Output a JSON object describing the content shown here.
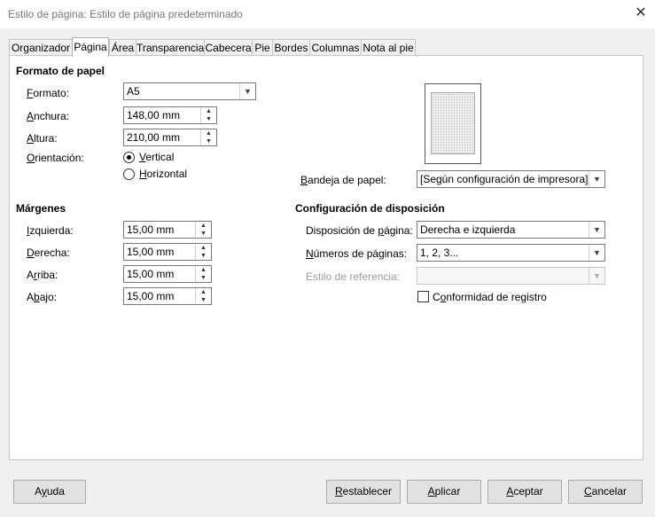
{
  "window": {
    "title": "Estilo de página: Estilo de página predeterminado",
    "close_glyph": "✕"
  },
  "tabs": [
    {
      "label": "Organizador",
      "active": false
    },
    {
      "label": "Página",
      "active": true
    },
    {
      "label": "Área",
      "active": false
    },
    {
      "label": "Transparencia",
      "active": false
    },
    {
      "label": "Cabecera",
      "active": false
    },
    {
      "label": "Pie",
      "active": false
    },
    {
      "label": "Bordes",
      "active": false
    },
    {
      "label": "Columnas",
      "active": false
    },
    {
      "label": "Nota al pie",
      "active": false
    }
  ],
  "paper_format": {
    "heading": "Formato de papel",
    "format": {
      "label_ul": "F",
      "label_rest": "ormato:",
      "value": "A5"
    },
    "width": {
      "label_ul": "A",
      "label_rest": "nchura:",
      "value": "148,00 mm"
    },
    "height": {
      "label_ul": "A",
      "label_rest": "ltura:",
      "value": "210,00 mm"
    },
    "orientation": {
      "label_ul": "O",
      "label_rest": "rientación:",
      "vertical": {
        "label_ul": "V",
        "label_rest": "ertical",
        "selected": true
      },
      "horizontal": {
        "label_ul": "H",
        "label_rest": "orizontal",
        "selected": false
      }
    },
    "tray": {
      "label_ul": "B",
      "label_rest": "andeja de papel:",
      "value": "[Según configuración de impresora]"
    }
  },
  "margins": {
    "heading": "Márgenes",
    "left": {
      "label_ul": "I",
      "label_rest": "zquierda:",
      "value": "15,00 mm"
    },
    "right": {
      "label_ul": "D",
      "label_rest": "erecha:",
      "value": "15,00 mm"
    },
    "top": {
      "label_pre": "A",
      "label_ul": "r",
      "label_rest": "riba:",
      "value": "15,00 mm"
    },
    "bottom": {
      "label_pre": "A",
      "label_ul": "b",
      "label_rest": "ajo:",
      "value": "15,00 mm"
    }
  },
  "layout": {
    "heading": "Configuración de disposición",
    "page_layout": {
      "label_pre": "Disposición de ",
      "label_ul": "p",
      "label_rest": "ágina:",
      "value": "Derecha e izquierda"
    },
    "page_numbers": {
      "label_ul": "N",
      "label_rest": "úmeros de páginas:",
      "value": "1, 2, 3..."
    },
    "reference_style": {
      "label": "Estilo de referencia:",
      "value": ""
    },
    "register_true": {
      "label_pre": "C",
      "label_ul": "o",
      "label_rest": "nformidad de registro",
      "checked": false
    }
  },
  "buttons": {
    "help": {
      "label_pre": "A",
      "label_ul": "y",
      "label_rest": "uda"
    },
    "reset": {
      "label_ul": "R",
      "label_rest": "establecer"
    },
    "apply": {
      "label_ul": "A",
      "label_rest": "plicar"
    },
    "ok": {
      "label_ul": "A",
      "label_rest": "ceptar"
    },
    "cancel": {
      "label_ul": "C",
      "label_rest": "ancelar"
    }
  },
  "icons": {
    "dropdown": "▼",
    "spin_up": "▲",
    "spin_down": "▼"
  }
}
